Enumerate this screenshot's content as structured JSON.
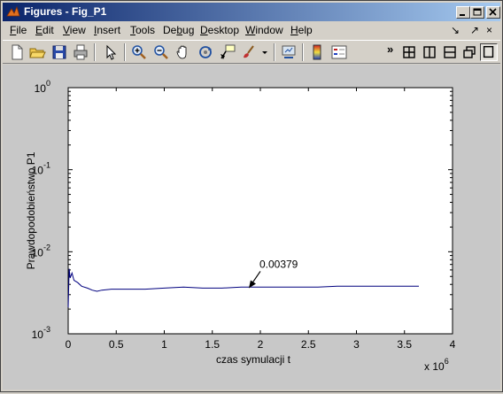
{
  "window": {
    "title": "Figures - Fig_P1",
    "controls": [
      "_",
      "□",
      "×"
    ]
  },
  "menubar": {
    "items": [
      {
        "label": "File",
        "u": "F",
        "rest": "ile"
      },
      {
        "label": "Edit",
        "u": "E",
        "rest": "dit"
      },
      {
        "label": "View",
        "u": "V",
        "rest": "iew"
      },
      {
        "label": "Insert",
        "u": "I",
        "rest": "nsert"
      },
      {
        "label": "Tools",
        "u": "T",
        "rest": "ools"
      },
      {
        "label": "Debug",
        "pre": "De",
        "u": "b",
        "rest": "ug"
      },
      {
        "label": "Desktop",
        "u": "D",
        "rest": "esktop"
      },
      {
        "label": "Window",
        "u": "W",
        "rest": "indow"
      },
      {
        "label": "Help",
        "u": "H",
        "rest": "elp"
      }
    ],
    "right_icons": [
      "↘",
      "↗"
    ]
  },
  "toolbar": {
    "icons": [
      "new-figure-icon",
      "open-file-icon",
      "save-icon",
      "print-icon",
      "edit-plot-arrow-icon",
      "zoom-in-icon",
      "zoom-out-icon",
      "pan-hand-icon",
      "rotate-3d-icon",
      "data-cursor-icon",
      "brush-icon",
      "brush-dropdown-icon",
      "link-plot-icon",
      "colorbar-icon",
      "legend-icon",
      "overflow-chevron-icon",
      "tile-icon",
      "split-vertical-icon",
      "split-horizontal-icon",
      "float-icon",
      "maximize-icon"
    ],
    "overflow_glyph": "»"
  },
  "chart_data": {
    "type": "line",
    "xlabel": "czas symulacji t",
    "ylabel": "Prawdopodobieństwo P1",
    "xlim": [
      0,
      4
    ],
    "x_scale_label": "x 10",
    "x_scale_exp": "6",
    "x_ticks": [
      "0",
      "0.5",
      "1",
      "1.5",
      "2",
      "2.5",
      "3",
      "3.5",
      "4"
    ],
    "ylim_exp": [
      -3,
      0
    ],
    "y_scale": "log",
    "y_ticks": [
      {
        "base": "10",
        "exp": "0"
      },
      {
        "base": "10",
        "exp": "-1"
      },
      {
        "base": "10",
        "exp": "-2"
      },
      {
        "base": "10",
        "exp": "-3"
      }
    ],
    "grid": false,
    "line_color": "#00007f",
    "series": [
      {
        "x": [
          0.0,
          0.01,
          0.02,
          0.04,
          0.06,
          0.1,
          0.14,
          0.2,
          0.25,
          0.3,
          0.35,
          0.45,
          0.6,
          0.8,
          1.0,
          1.2,
          1.4,
          1.6,
          1.8,
          2.0,
          2.2,
          2.4,
          2.6,
          2.8,
          3.0,
          3.2,
          3.4,
          3.6,
          3.65
        ],
        "y": [
          0.0021,
          0.0062,
          0.0048,
          0.0055,
          0.0045,
          0.0042,
          0.0038,
          0.0036,
          0.0034,
          0.0033,
          0.0034,
          0.0035,
          0.0035,
          0.0035,
          0.0036,
          0.0037,
          0.0036,
          0.0036,
          0.0037,
          0.0037,
          0.0037,
          0.0037,
          0.0037,
          0.0038,
          0.0038,
          0.0038,
          0.0038,
          0.0038,
          0.0038
        ]
      }
    ],
    "annotation": {
      "text": "0.00379",
      "x": 1.88,
      "y": 0.0036
    }
  }
}
